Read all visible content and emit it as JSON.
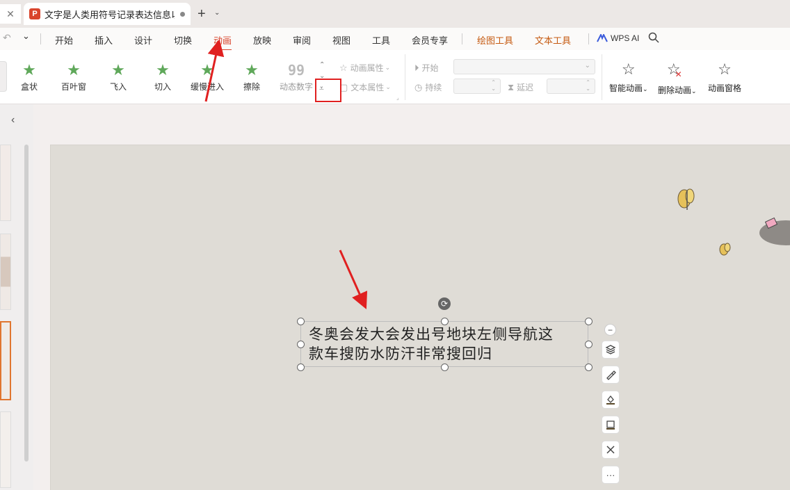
{
  "tabbar": {
    "prev_tab_close": "✕",
    "doc_icon_letter": "P",
    "doc_title": "文字是人类用符号记录表达信息以",
    "new_tab": "+",
    "new_tab_caret": "⌄"
  },
  "menu": {
    "undo": "↶",
    "more": "⌄",
    "items": [
      "开始",
      "插入",
      "设计",
      "切换",
      "动画",
      "放映",
      "审阅",
      "视图",
      "工具",
      "会员专享"
    ],
    "active": "动画",
    "context_items": [
      "绘图工具",
      "文本工具"
    ],
    "wps_ai": "WPS AI"
  },
  "ribbon": {
    "animations": [
      "盒状",
      "百叶窗",
      "飞入",
      "切入",
      "缓慢进入",
      "擦除",
      "动态数字"
    ],
    "dynamic_number_icon": "99",
    "animation_props": "动画属性",
    "text_props": "文本属性",
    "start_label": "开始",
    "duration_label": "持续",
    "delay_label": "延迟",
    "tools": [
      "智能动画",
      "删除动画",
      "动画窗格"
    ]
  },
  "slide": {
    "text_line1": "冬奥会发大会发出号地块左侧导航这",
    "text_line2": "款车搜防水防汗非常搜回归"
  },
  "float_toolbar": {
    "minus": "−",
    "more": "···"
  },
  "colors": {
    "accent": "#d9442c",
    "context": "#c55a11",
    "annotation": "#e02020",
    "star": "#5fa85a"
  }
}
